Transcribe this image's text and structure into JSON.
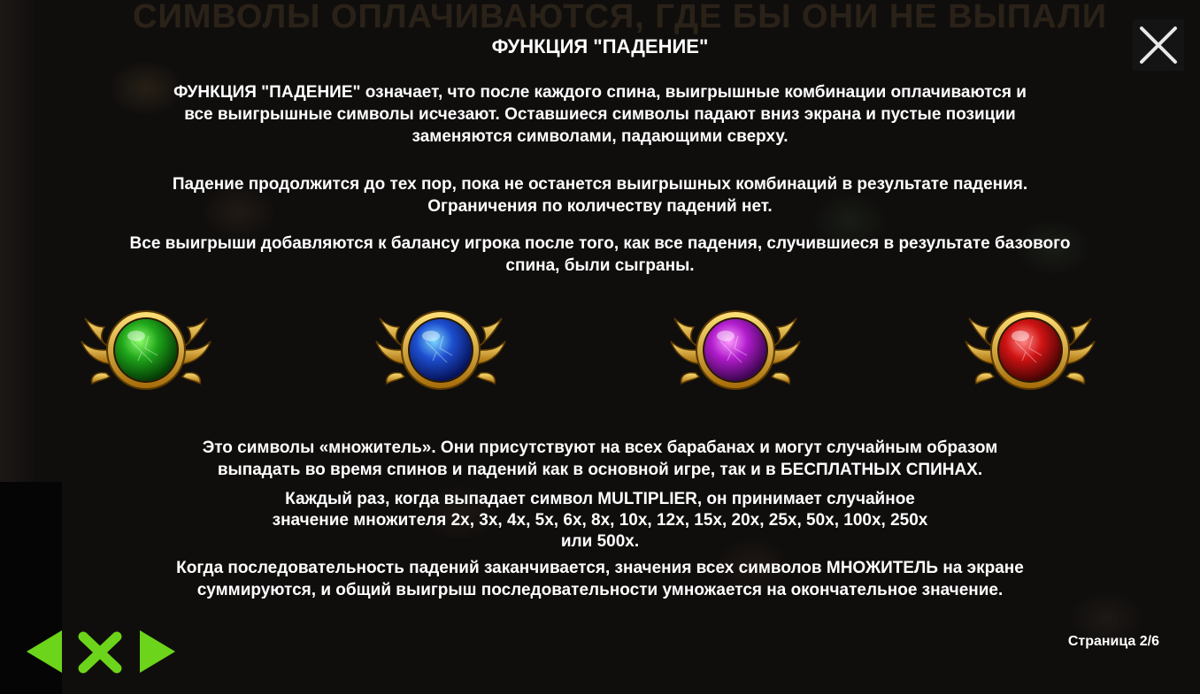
{
  "background": {
    "headline": "СИМВОЛЫ ОПЛАЧИВАЮТСЯ, ГДЕ БЫ ОНИ НЕ ВЫПАЛИ"
  },
  "title": "ФУНКЦИЯ \"ПАДЕНИЕ\"",
  "paragraphs": {
    "p1": [
      "ФУНКЦИЯ \"ПАДЕНИЕ\" означает, что после каждого спина, выигрышные комбинации оплачиваются и",
      "все выигрышные символы исчезают. Оставшиеся символы падают вниз экрана и пустые позиции",
      "заменяются символами, падающими сверху."
    ],
    "p2": [
      "Падение продолжится до тех пор, пока не останется выигрышных комбинаций в результате падения.",
      "Ограничения по количеству падений нет."
    ],
    "p3": [
      "Все выигрыши добавляются к балансу игрока после того, как все падения, случившиеся в результате базового",
      "спина, были сыграны."
    ],
    "p4": [
      "Это символы «множитель». Они присутствуют на всех барабанах и могут случайным образом",
      "выпадать во время спинов и падений как в основной игре, так и в БЕСПЛАТНЫХ СПИНАХ."
    ],
    "p5": [
      "Каждый раз, когда выпадает символ MULTIPLIER, он принимает случайное",
      "значение множителя 2х, 3х, 4х, 5х, 6х, 8х, 10х, 12х, 15х, 20х, 25х, 50х, 100х, 250х",
      "или 500х."
    ],
    "p6": [
      "Когда последовательность падений заканчивается, значения всех символов МНОЖИТЕЛЬ на экране",
      "суммируются, и общий выигрыш последовательности умножается на окончательное значение."
    ]
  },
  "orbs": [
    {
      "name": "green",
      "light": "#8dff6a",
      "mid": "#1fa51a",
      "dark": "#053d05"
    },
    {
      "name": "blue",
      "light": "#7ad8ff",
      "mid": "#1d4fd0",
      "dark": "#07135a"
    },
    {
      "name": "purple",
      "light": "#ff9cff",
      "mid": "#b01ccc",
      "dark": "#3d0650"
    },
    {
      "name": "red",
      "light": "#ff8a8a",
      "mid": "#d01313",
      "dark": "#4a0404"
    }
  ],
  "colors": {
    "gold_light": "#ffe27a",
    "gold_dark": "#a56a07",
    "nav_green": "#6cd41a"
  },
  "icons": {
    "close": "close-icon",
    "prev": "arrow-left-icon",
    "exit": "x-icon",
    "next": "arrow-right-icon"
  },
  "pagination": "Страница 2/6"
}
